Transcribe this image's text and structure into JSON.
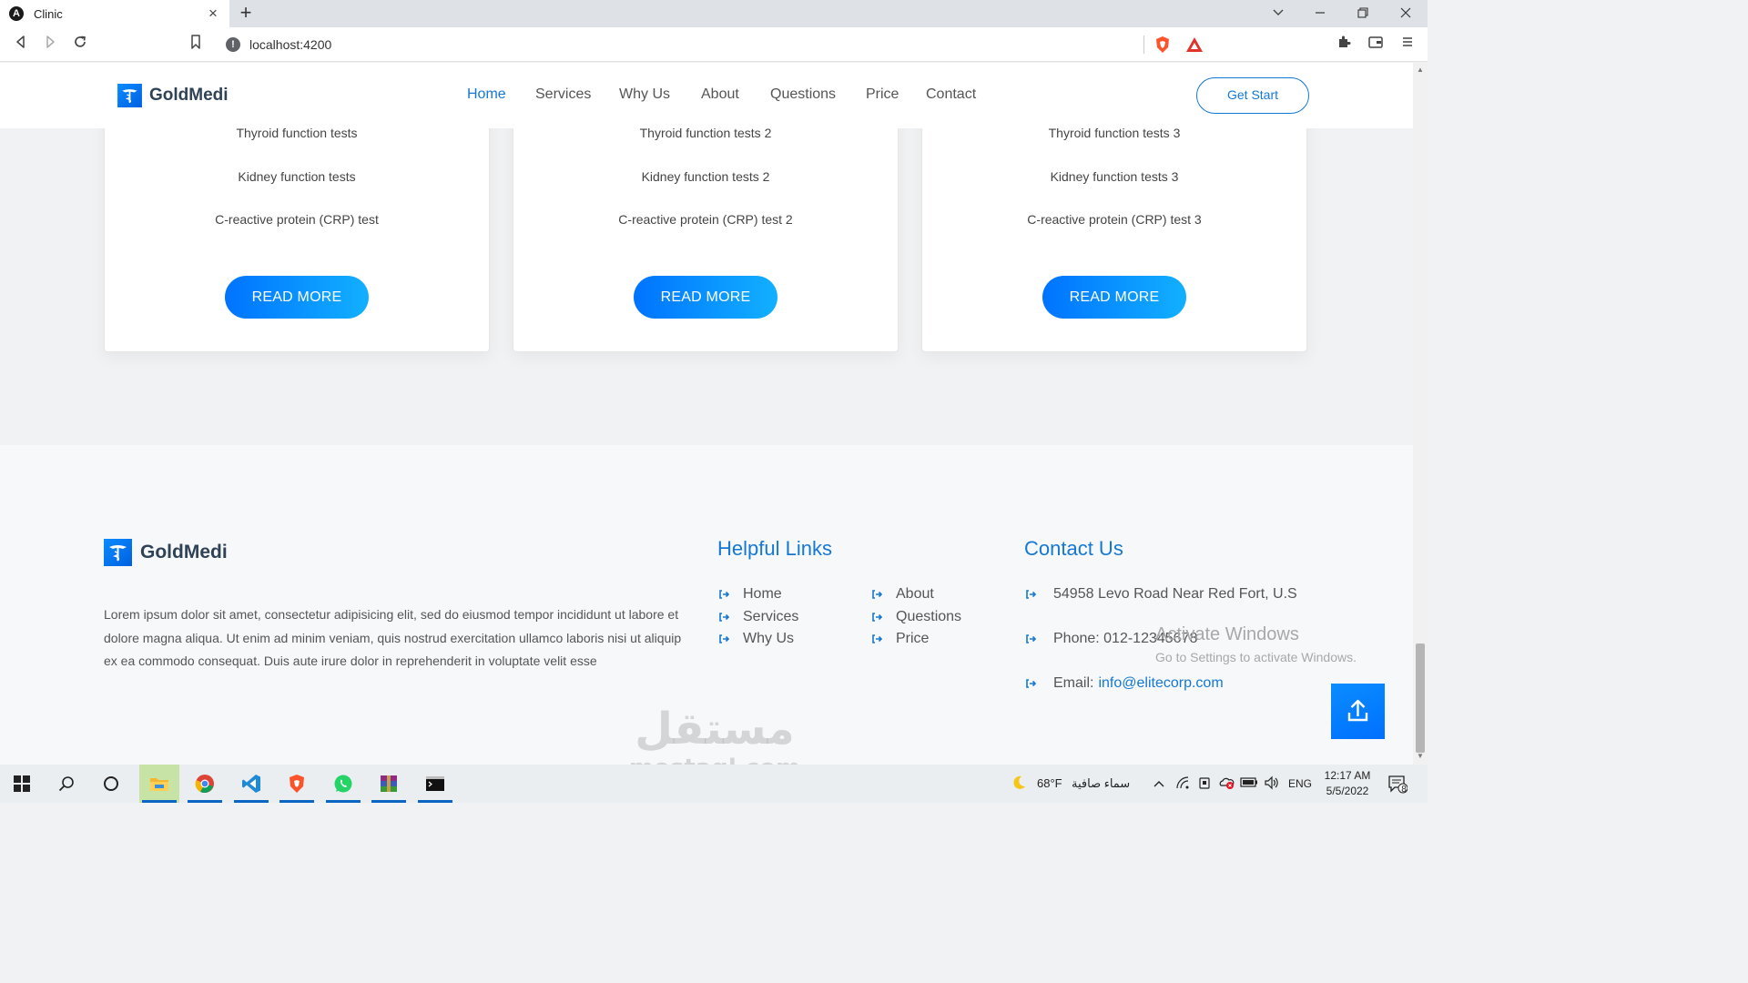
{
  "browser": {
    "tab_title": "Clinic",
    "url": "localhost:4200"
  },
  "site": {
    "logo_text": "GoldMedi",
    "nav": [
      "Home",
      "Services",
      "Why Us",
      "About",
      "Questions",
      "Price",
      "Contact"
    ],
    "active_nav": "Home",
    "cta_label": "Get Start"
  },
  "cards": [
    {
      "lines": [
        "Thyroid function tests",
        "Kidney function tests",
        "C-reactive protein (CRP) test"
      ],
      "button": "READ MORE"
    },
    {
      "lines": [
        "Thyroid function tests 2",
        "Kidney function tests 2",
        "C-reactive protein (CRP) test 2"
      ],
      "button": "READ MORE"
    },
    {
      "lines": [
        "Thyroid function tests 3",
        "Kidney function tests 3",
        "C-reactive protein (CRP) test 3"
      ],
      "button": "READ MORE"
    }
  ],
  "footer": {
    "logo_text": "GoldMedi",
    "description": "Lorem ipsum dolor sit amet, consectetur adipisicing elit, sed do eiusmod tempor incididunt ut labore et dolore magna aliqua. Ut enim ad minim veniam, quis nostrud exercitation ullamco laboris nisi ut aliquip ex ea commodo consequat. Duis aute irure dolor in reprehenderit in voluptate velit esse",
    "helpful_links_title": "Helpful Links",
    "links_col1": [
      "Home",
      "Services",
      "Why Us"
    ],
    "links_col2": [
      "About",
      "Questions",
      "Price"
    ],
    "contact_title": "Contact Us",
    "address": "54958 Levo Road Near Red Fort, U.S",
    "phone": "Phone: 012-12345678",
    "email_label": "Email:",
    "email": "info@elitecorp.com"
  },
  "overlays": {
    "activate_title": "Activate Windows",
    "activate_sub": "Go to Settings to activate Windows.",
    "watermark_ar": "مستقل",
    "watermark_en": "mostaql.com"
  },
  "taskbar": {
    "weather_temp": "68°F",
    "weather_desc": "سماء صافية",
    "language": "ENG",
    "time": "12:17 AM",
    "date": "5/5/2022",
    "notifications": "8"
  },
  "colors": {
    "accent": "#1478d4",
    "button_gradient_start": "#0073ff",
    "button_gradient_end": "#12b0ff",
    "footer_bg": "#f6f8f9"
  }
}
